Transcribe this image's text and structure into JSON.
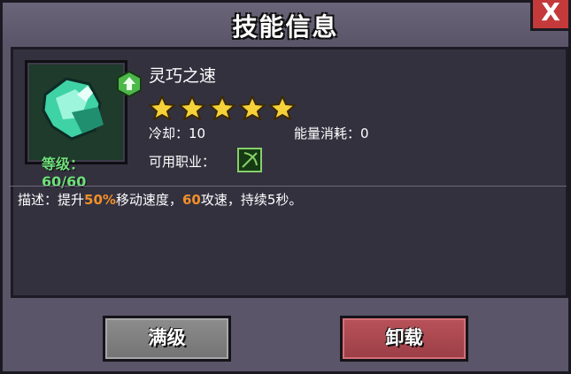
{
  "dialog": {
    "title": "技能信息",
    "close_label": "X"
  },
  "skill": {
    "name": "灵巧之速",
    "level_label": "等级：60/60",
    "stars": 5,
    "cooldown_label": "冷却：10",
    "energy_label": "能量消耗：0",
    "job_label": "可用职业：",
    "job_icon": "bow-class-icon",
    "description_parts": {
      "prefix": "描述：提升",
      "pct": "50%",
      "mid": "移动速度，",
      "atk": "60",
      "suffix": "攻速，持续5秒。"
    }
  },
  "buttons": {
    "max_label": "满级",
    "unload_label": "卸载"
  },
  "colors": {
    "highlight": "#f0902a",
    "level_text": "#6ee07a",
    "unload_button": "#b9525a",
    "max_button": "#8d8d8d"
  }
}
